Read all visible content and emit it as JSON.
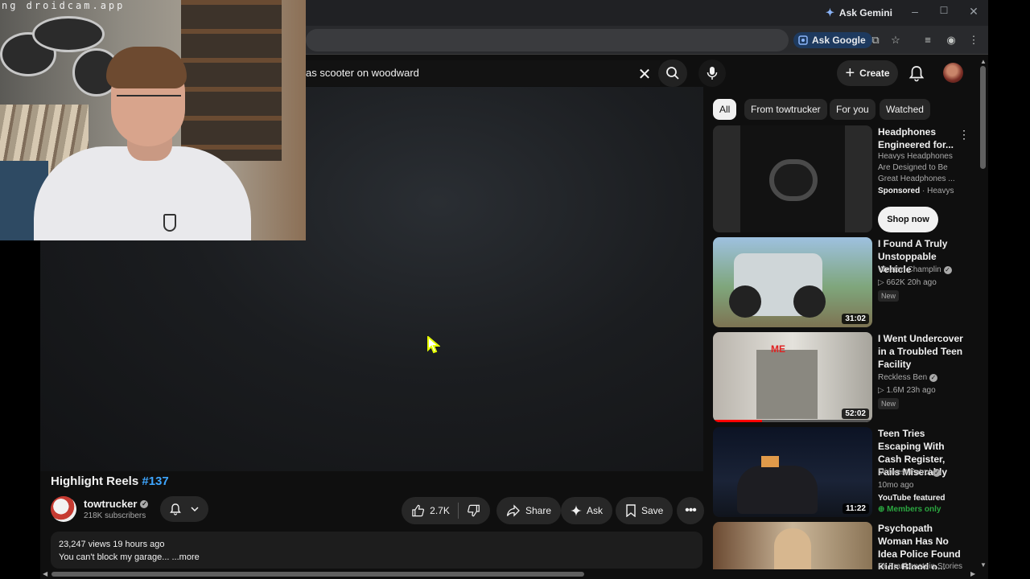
{
  "browser": {
    "ask_gemini": "Ask Gemini",
    "ask_google": "Ask Google",
    "window_controls": [
      "–",
      "☐",
      "✕"
    ]
  },
  "webcam": {
    "watermark": "ng droidcam.app"
  },
  "header": {
    "search_query": "as scooter on woodward",
    "create_label": "Create"
  },
  "video": {
    "title": "Highlight Reels",
    "title_tag": "#137",
    "channel_name": "towtrucker",
    "subscribers": "218K subscribers",
    "likes": "2.7K",
    "share_label": "Share",
    "ask_label": "Ask",
    "save_label": "Save",
    "views_time": "23,247 views  19 hours ago",
    "description": "You can't block my garage... ",
    "more_label": "...more"
  },
  "chips": [
    "All",
    "From towtrucker",
    "For you",
    "Watched"
  ],
  "sidebar": {
    "ad": {
      "title": "Headphones Engineered for...",
      "desc": "Heavys Headphones Are Designed to Be Great Headphones ...",
      "sponsored": "Sponsored",
      "advertiser": "Heavys",
      "cta": "Shop now"
    },
    "items": [
      {
        "title": "I Found A Truly Unstoppable Vehicle",
        "channel": "Westen Champlin",
        "meta": "662K  20h ago",
        "badge": "New",
        "duration": "31:02"
      },
      {
        "title": "I Went Undercover in a Troubled Teen Facility",
        "channel": "Reckless Ben",
        "meta": "1.6M  23h ago",
        "badge": "New",
        "duration": "52:02",
        "progress": 0.31
      },
      {
        "title": "Teen Tries Escaping With Cash Register, Fails Miserably",
        "channel": "Midwest Patrol",
        "meta": "10mo ago",
        "featured": "YouTube featured",
        "members": "Members only",
        "duration": "11:22"
      },
      {
        "title": "Psychopath Woman Has No Idea Police Found Kids Blood o...",
        "channel": "Dr Frankenstein Stories"
      }
    ]
  },
  "colors": {
    "background": "#0f0f0f",
    "accent_link": "#3ea6ff",
    "members_green": "#2ba640",
    "progress_red": "#ff0000"
  }
}
